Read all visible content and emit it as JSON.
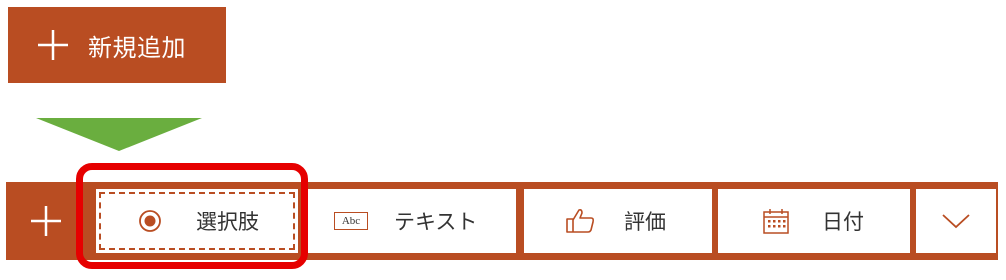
{
  "add_button": {
    "label": "新規追加",
    "icon": "plus-icon"
  },
  "toolbar": {
    "add_icon": "plus-icon",
    "choices": [
      {
        "label": "選択肢",
        "icon": "radio-icon",
        "selected": true
      },
      {
        "label": "テキスト",
        "icon": "text-abc-icon",
        "icon_text": "Abc"
      },
      {
        "label": "評価",
        "icon": "thumbs-up-icon"
      },
      {
        "label": "日付",
        "icon": "calendar-icon"
      },
      {
        "label": "",
        "icon": "chevron-down-icon"
      }
    ]
  },
  "colors": {
    "accent": "#b94d22",
    "arrow": "#6aae3f",
    "highlight": "#e60000"
  }
}
